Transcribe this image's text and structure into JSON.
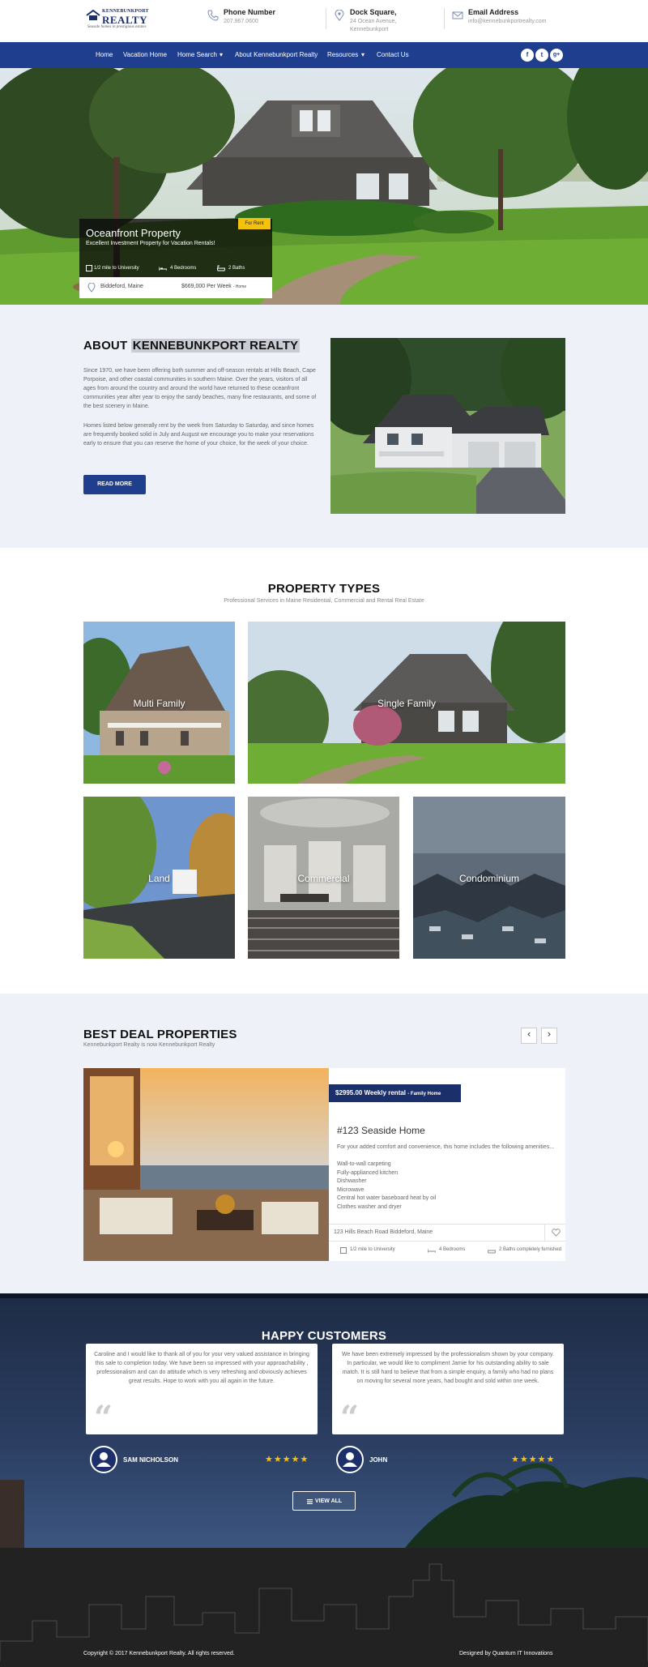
{
  "colors": {
    "primary": "#1f3f8e",
    "accent": "#f4c20d",
    "dark": "#222222",
    "light_bg": "#eef1f8"
  },
  "header": {
    "logo": {
      "line1": "KENNEBUNKPORT",
      "line2": "REALTY",
      "tagline": "Seaside homes in prestigious estates"
    },
    "phone": {
      "icon": "phone-icon",
      "title": "Phone Number",
      "value": "207.967.0600"
    },
    "address": {
      "icon": "map-pin-icon",
      "title": "Dock Square,",
      "value": "24 Ocean Avenue, Kennebunkport"
    },
    "email": {
      "icon": "envelope-icon",
      "title": "Email Address",
      "value": "info@kennebunkportrealty.com"
    }
  },
  "nav": {
    "items": [
      "Home",
      "Vacation Home",
      "Home Search",
      "About Kennebunkport Realty",
      "Resources",
      "Contact Us"
    ],
    "dropdown_marker": "▾",
    "social": [
      "f",
      "t",
      "g+"
    ]
  },
  "hero": {
    "badge": "For Rent",
    "title": "Oceanfront Property",
    "subtitle": "Excellent Investment Property for Vacation Rentals!",
    "features": [
      "1/2 mile to University",
      "4 Bedrooms",
      "2 Baths"
    ],
    "location": "Biddeford, Maine",
    "price": "$669,000 Per Week",
    "price_type": "- Home"
  },
  "about": {
    "title_prefix": "ABOUT ",
    "title_highlight": "KENNEBUNKPORT REALTY",
    "p1": "Since 1970, we have been offering both summer and off-season rentals at Hills Beach, Cape Porpoise, and other coastal communities in southern Maine. Over the years, visitors of all ages from around the country and around the world have returned to these oceanfront communities year after year to enjoy the sandy beaches, many fine restaurants, and some of the best scenery in Maine.",
    "p2": "Homes listed below generally rent by the week from Saturday to Saturday, and since homes are frequently booked solid in July and August we encourage you to make your reservations early to ensure that you can reserve the home of your choice, for the week of your choice.",
    "button": "READ MORE"
  },
  "types": {
    "title": "PROPERTY TYPES",
    "subtitle": "Professional Services in Maine Residential, Commercial and Rental Real Estate",
    "tiles": [
      "Multi Family",
      "Single Family",
      "Land",
      "Commercial",
      "Condominium"
    ]
  },
  "deals": {
    "title": "BEST DEAL PROPERTIES",
    "subtitle": "Kennebunkport Realty is now Kennebunkport Realty",
    "prev": "‹",
    "next": "›",
    "price": "$2995.00 Weekly rental",
    "price_type": "- Family Home",
    "name": "#123 Seaside Home",
    "desc": "For your added comfort and convenience, this home includes the following amenities...",
    "amenities": [
      "Wall-to-wall carpeting",
      "Fully-applianced kitchen",
      "Dishwasher",
      "Microwave",
      "Central hot water baseboard heat by oil",
      "Clothes washer and dryer"
    ],
    "address": "123 Hills Beach Road Biddeford, Maine",
    "features": [
      "1/2 mile to University",
      "4 Bedrooms",
      "2 Baths completely furnished"
    ]
  },
  "customers": {
    "title": "HAPPY CUSTOMERS",
    "items": [
      {
        "quote": "Caroline and I would like to thank all of you for your very valued assistance in bringing this sale to completion today. We have been so impressed with your approachability , professionalism and can do attitude which is very refreshing and obviously achieves great results. Hope to work with you all again in the future.",
        "name": "SAM NICHOLSON",
        "rating": 5
      },
      {
        "quote": "We have been extremely impressed by the professionalism shown by your company. In particular, we would like to compliment Jamie for his outstanding ability to sale match. It is still hard to believe that from a simple enquiry, a family who had no plans on moving for several more years, had bought and sold within one week.",
        "name": "JOHN",
        "rating": 5
      }
    ],
    "stars_text": "★★★★★",
    "quote_mark": "“",
    "button": "VIEW ALL"
  },
  "footer": {
    "copyright": "Copyright © 2017 Kennebunkport Realty. All rights reserved.",
    "credit": "Designed by Quantum IT Innovations"
  }
}
